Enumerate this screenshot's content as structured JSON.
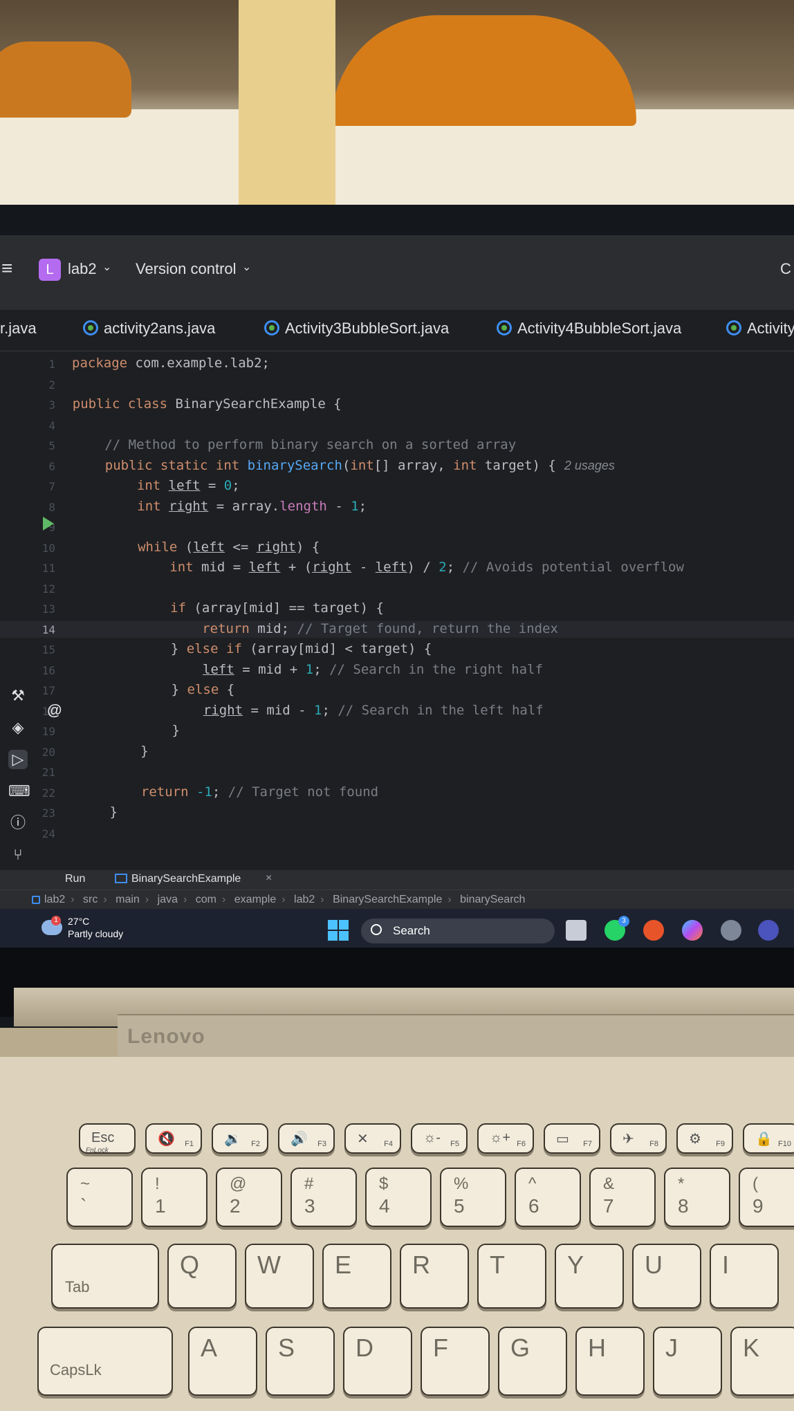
{
  "ide": {
    "project_badge": "L",
    "project_name": "lab2",
    "version_control": "Version control",
    "corner_text": "C",
    "tabs": [
      {
        "label": "r.java"
      },
      {
        "label": "activity2ans.java"
      },
      {
        "label": "Activity3BubbleSort.java"
      },
      {
        "label": "Activity4BubbleSort.java"
      },
      {
        "label": "Activity"
      }
    ],
    "hint_usages": "2 usages",
    "run_label": "Run",
    "run_tab": "BinarySearchExample",
    "run_tab_close": "×",
    "breadcrumb": [
      "lab2",
      "src",
      "main",
      "java",
      "com",
      "example",
      "lab2",
      "BinarySearchExample",
      "binarySearch"
    ],
    "current_line": 14
  },
  "code_lines": [
    {
      "n": "1",
      "parts": [
        [
          "kw",
          "package "
        ],
        [
          "",
          "com.example.lab2;"
        ]
      ]
    },
    {
      "n": "2",
      "parts": []
    },
    {
      "n": "3",
      "parts": [
        [
          "kw",
          "public class "
        ],
        [
          "",
          "BinarySearchExample {"
        ]
      ]
    },
    {
      "n": "4",
      "parts": []
    },
    {
      "n": "5",
      "parts": [
        [
          "cmt",
          "    // Method to perform binary search on a sorted array"
        ]
      ]
    },
    {
      "n": "6",
      "parts": [
        [
          "kw",
          "    public static int "
        ],
        [
          "fn",
          "binarySearch"
        ],
        [
          "",
          "("
        ],
        [
          "kw",
          "int"
        ],
        [
          "",
          "[] array, "
        ],
        [
          "kw",
          "int "
        ],
        [
          "",
          "target) {"
        ]
      ]
    },
    {
      "n": "7",
      "parts": [
        [
          "kw",
          "        int "
        ],
        [
          "ul",
          "left"
        ],
        [
          "",
          " = "
        ],
        [
          "num",
          "0"
        ],
        [
          "",
          ";"
        ]
      ]
    },
    {
      "n": "8",
      "parts": [
        [
          "kw",
          "        int "
        ],
        [
          "ul",
          "right"
        ],
        [
          "",
          " = array."
        ],
        [
          "fld",
          "length"
        ],
        [
          "",
          " - "
        ],
        [
          "num",
          "1"
        ],
        [
          "",
          ";"
        ]
      ]
    },
    {
      "n": "9",
      "parts": []
    },
    {
      "n": "10",
      "parts": [
        [
          "kw",
          "        while "
        ],
        [
          "",
          "("
        ],
        [
          "ul",
          "left"
        ],
        [
          "",
          " <= "
        ],
        [
          "ul",
          "right"
        ],
        [
          "",
          ") {"
        ]
      ]
    },
    {
      "n": "11",
      "parts": [
        [
          "kw",
          "            int "
        ],
        [
          "",
          "mid = "
        ],
        [
          "ul",
          "left"
        ],
        [
          "",
          " + ("
        ],
        [
          "ul",
          "right"
        ],
        [
          "",
          " - "
        ],
        [
          "ul",
          "left"
        ],
        [
          "",
          ") / "
        ],
        [
          "num",
          "2"
        ],
        [
          "",
          "; "
        ],
        [
          "cmt",
          "// Avoids potential overflow"
        ]
      ]
    },
    {
      "n": "12",
      "parts": []
    },
    {
      "n": "13",
      "parts": [
        [
          "kw",
          "            if "
        ],
        [
          "",
          "(array[mid] == target) {"
        ]
      ]
    },
    {
      "n": "14",
      "parts": [
        [
          "kw",
          "                return "
        ],
        [
          "",
          "mid; "
        ],
        [
          "cmt",
          "// Target found, return the index"
        ]
      ]
    },
    {
      "n": "15",
      "parts": [
        [
          "",
          "            } "
        ],
        [
          "kw",
          "else if "
        ],
        [
          "",
          "(array[mid] < target) {"
        ]
      ]
    },
    {
      "n": "16",
      "parts": [
        [
          "",
          "                "
        ],
        [
          "ul",
          "left"
        ],
        [
          "",
          " = mid + "
        ],
        [
          "num",
          "1"
        ],
        [
          "",
          "; "
        ],
        [
          "cmt",
          "// Search in the right half"
        ]
      ]
    },
    {
      "n": "17",
      "parts": [
        [
          "",
          "            } "
        ],
        [
          "kw",
          "else "
        ],
        [
          "",
          "{"
        ]
      ]
    },
    {
      "n": "18",
      "parts": [
        [
          "",
          "                "
        ],
        [
          "ul",
          "right"
        ],
        [
          "",
          " = mid - "
        ],
        [
          "num",
          "1"
        ],
        [
          "",
          "; "
        ],
        [
          "cmt",
          "// Search in the left half"
        ]
      ]
    },
    {
      "n": "19",
      "parts": [
        [
          "",
          "            }"
        ]
      ]
    },
    {
      "n": "20",
      "parts": [
        [
          "",
          "        }"
        ]
      ]
    },
    {
      "n": "21",
      "parts": []
    },
    {
      "n": "22",
      "parts": [
        [
          "kw",
          "        return "
        ],
        [
          "num",
          "-1"
        ],
        [
          "",
          "; "
        ],
        [
          "cmt",
          "// Target not found"
        ]
      ]
    },
    {
      "n": "23",
      "parts": [
        [
          "",
          "    }"
        ]
      ]
    },
    {
      "n": "24",
      "parts": []
    }
  ],
  "taskbar": {
    "temperature": "27°C",
    "condition": "Partly cloudy",
    "weather_badge": "1",
    "search_label": "Search",
    "whatsapp_badge": "3"
  },
  "laptop": {
    "brand": "Lenovo"
  },
  "keyboard": {
    "fn_row": [
      {
        "sym": "Esc",
        "fn": "FnLock"
      },
      {
        "sym": "🔇",
        "fn": "F1"
      },
      {
        "sym": "🔉",
        "fn": "F2"
      },
      {
        "sym": "🔊",
        "fn": "F3"
      },
      {
        "sym": "✕",
        "fn": "F4"
      },
      {
        "sym": "☼-",
        "fn": "F5"
      },
      {
        "sym": "☼+",
        "fn": "F6"
      },
      {
        "sym": "▭",
        "fn": "F7"
      },
      {
        "sym": "✈",
        "fn": "F8"
      },
      {
        "sym": "⚙",
        "fn": "F9"
      },
      {
        "sym": "🔒",
        "fn": "F10"
      }
    ],
    "number_row": [
      {
        "top": "~",
        "main": "`"
      },
      {
        "top": "!",
        "main": "1"
      },
      {
        "top": "@",
        "main": "2"
      },
      {
        "top": "#",
        "main": "3"
      },
      {
        "top": "$",
        "main": "4"
      },
      {
        "top": "%",
        "main": "5"
      },
      {
        "top": "^",
        "main": "6"
      },
      {
        "top": "&",
        "main": "7"
      },
      {
        "top": "*",
        "main": "8"
      },
      {
        "top": "(",
        "main": "9"
      }
    ],
    "top_row": [
      "Tab",
      "Q",
      "W",
      "E",
      "R",
      "T",
      "Y",
      "U",
      "I"
    ],
    "home_row": [
      "CapsLk",
      "A",
      "S",
      "D",
      "F",
      "G",
      "H",
      "J",
      "K"
    ]
  }
}
